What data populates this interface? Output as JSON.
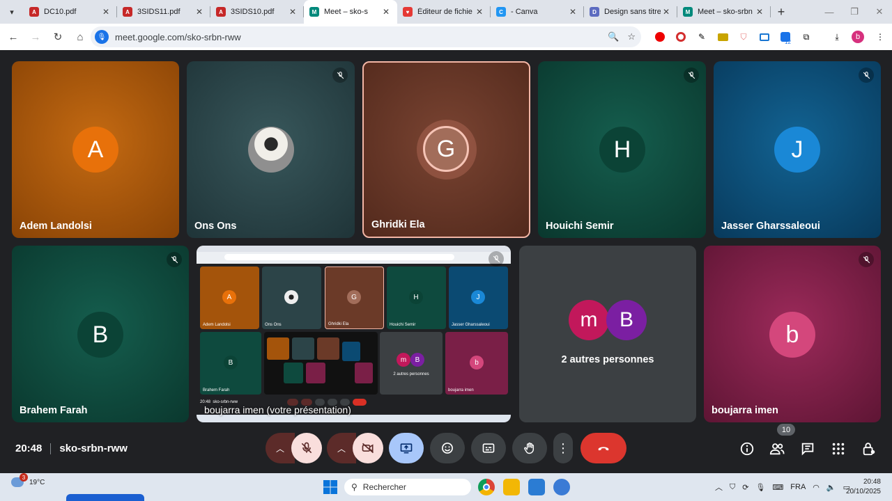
{
  "browser": {
    "tabs": [
      {
        "label": "DC10.pdf",
        "color": "#c62828",
        "glyph": "A",
        "active": false
      },
      {
        "label": "3SIDS11.pdf",
        "color": "#c62828",
        "glyph": "A",
        "active": false
      },
      {
        "label": "3SIDS10.pdf",
        "color": "#c62828",
        "glyph": "A",
        "active": false
      },
      {
        "label": "Meet – sko-s",
        "color": "#00897b",
        "glyph": "M",
        "active": true
      },
      {
        "label": "Éditeur de fichie",
        "color": "#e53935",
        "glyph": "♥",
        "active": false
      },
      {
        "label": "- Canva",
        "color": "#2196f3",
        "glyph": "C",
        "active": false
      },
      {
        "label": "Design sans titre",
        "color": "#5c6bc0",
        "glyph": "D",
        "active": false
      },
      {
        "label": "Meet – sko-srbn",
        "color": "#00897b",
        "glyph": "M",
        "active": false
      }
    ],
    "new_tab": "+",
    "close_glyph": "✕",
    "url": "meet.google.com/sko-srbn-rww",
    "ext_badge": "12",
    "profile_initial": "b"
  },
  "tiles": [
    {
      "name": "Adem Landolsi",
      "initial": "A",
      "bg": "#b25c0b",
      "avatar_bg": "#e8710a",
      "muted": false
    },
    {
      "name": "Ons Ons",
      "initial": "",
      "bg": "#2c4448",
      "avatar_bg": "#d8d8d8",
      "muted": true
    },
    {
      "name": "Ghridki Ela",
      "initial": "G",
      "bg": "#6b3a28",
      "avatar_bg": "#a26d5a",
      "muted": false
    },
    {
      "name": "Houichi Semir",
      "initial": "H",
      "bg": "#0e4a3e",
      "avatar_bg": "#0b4336",
      "muted": true
    },
    {
      "name": "Jasser Gharssaleoui",
      "initial": "J",
      "bg": "#0b4a72",
      "avatar_bg": "#1a88d6",
      "muted": true
    },
    {
      "name": "Brahem Farah",
      "initial": "B",
      "bg": "#0e4a3e",
      "avatar_bg": "#0b4336",
      "muted": true
    },
    {
      "name": "boujarra imen",
      "initial": "b",
      "bg": "#7a1f47",
      "avatar_bg": "#d4477c",
      "muted": true
    }
  ],
  "presentation": {
    "name": "boujarra imen (votre présentation)",
    "mini_names": [
      "Adem Landolsi",
      "Ons Ons",
      "Ghridki Ela",
      "Houichi Semir",
      "Jasser Gharssaleoui",
      "Brahem Farah",
      "2 autres personnes",
      "boujarra imen"
    ],
    "mini_time": "20:48",
    "mini_code": "sko-srbn-rww"
  },
  "others": {
    "label": "2 autres personnes",
    "initials": [
      "m",
      "B"
    ],
    "colors": [
      "#c2185b",
      "#7b1fa2"
    ]
  },
  "meeting": {
    "time": "20:48",
    "code": "sko-srbn-rww",
    "participants_count": "10"
  },
  "taskbar": {
    "weather_temp": "19°C",
    "weather_badge": "3",
    "search_placeholder": "Rechercher",
    "lang": "FRA",
    "clock_time": "20:48",
    "clock_date": "20/10/2025"
  }
}
